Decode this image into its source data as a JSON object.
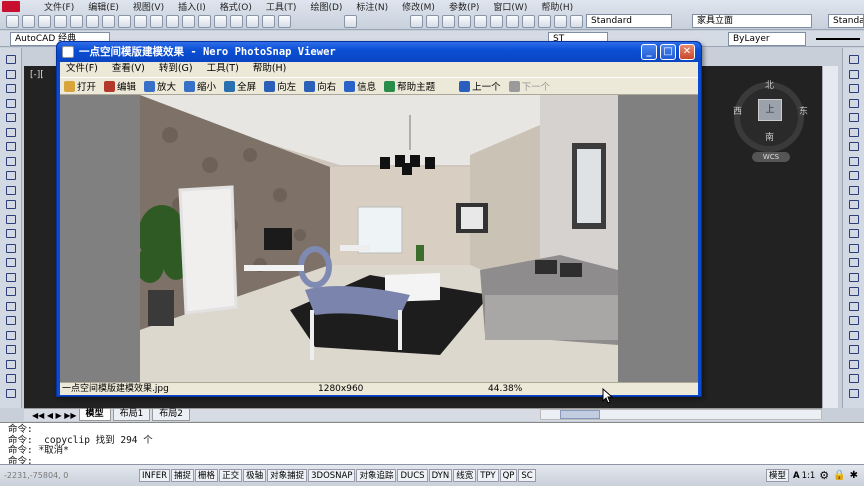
{
  "acad": {
    "menu": [
      "文件(F)",
      "编辑(E)",
      "视图(V)",
      "插入(I)",
      "格式(O)",
      "工具(T)",
      "绘图(D)",
      "标注(N)",
      "修改(M)",
      "参数(P)",
      "窗口(W)",
      "帮助(H)"
    ],
    "workspace": "AutoCAD 经典",
    "text_style": "Standard",
    "dim_style": "家具立面",
    "table_style": "Standard",
    "layer": "ST",
    "linetype": "ByLayer",
    "view_label": "[-][",
    "viewcube": {
      "top": "上",
      "north": "北",
      "south": "南",
      "east": "东",
      "west": "西",
      "wcs": "WCS"
    },
    "tabs": [
      "模型",
      "布局1",
      "布局2"
    ],
    "command_lines": [
      "命令:",
      "命令:  _copyclip 找到 294 个",
      "命令: *取消*"
    ],
    "prompt": "命令:",
    "coords": "-2231,-75804, 0",
    "status_buttons": [
      "INFER",
      "捕捉",
      "栅格",
      "正交",
      "极轴",
      "对象捕捉",
      "3DOSNAP",
      "对象追踪",
      "DUCS",
      "DYN",
      "线宽",
      "TPY",
      "QP",
      "SC"
    ],
    "status_right": {
      "model": "模型",
      "scale": "1:1"
    }
  },
  "viewer": {
    "title": "一点空间模版建模效果 - Nero PhotoSnap Viewer",
    "menu": [
      "文件(F)",
      "查看(V)",
      "转到(G)",
      "工具(T)",
      "帮助(H)"
    ],
    "toolbar": [
      {
        "label": "打开",
        "icon": "folder-open-icon",
        "color": "#d9a53a"
      },
      {
        "label": "编辑",
        "icon": "edit-icon",
        "color": "#b33a2b"
      },
      {
        "label": "放大",
        "icon": "zoom-in-icon",
        "color": "#3a6fc8"
      },
      {
        "label": "缩小",
        "icon": "zoom-out-icon",
        "color": "#3a6fc8"
      },
      {
        "label": "全屏",
        "icon": "fullscreen-icon",
        "color": "#2a6fb0"
      },
      {
        "label": "向左",
        "icon": "rotate-left-icon",
        "color": "#2b5fb8"
      },
      {
        "label": "向右",
        "icon": "rotate-right-icon",
        "color": "#2b5fb8"
      },
      {
        "label": "信息",
        "icon": "info-icon",
        "color": "#2a62c8"
      },
      {
        "label": "帮助主题",
        "icon": "help-icon",
        "color": "#2a8c4a"
      },
      {
        "label": "上一个",
        "icon": "previous-icon",
        "color": "#2a5fc0"
      },
      {
        "label": "下一个",
        "icon": "next-icon",
        "color": "#9a9a9a"
      }
    ],
    "status": {
      "filename": "一点空间模版建模效果.jpg",
      "dimensions": "1280x960",
      "zoom": "44.38%"
    }
  }
}
